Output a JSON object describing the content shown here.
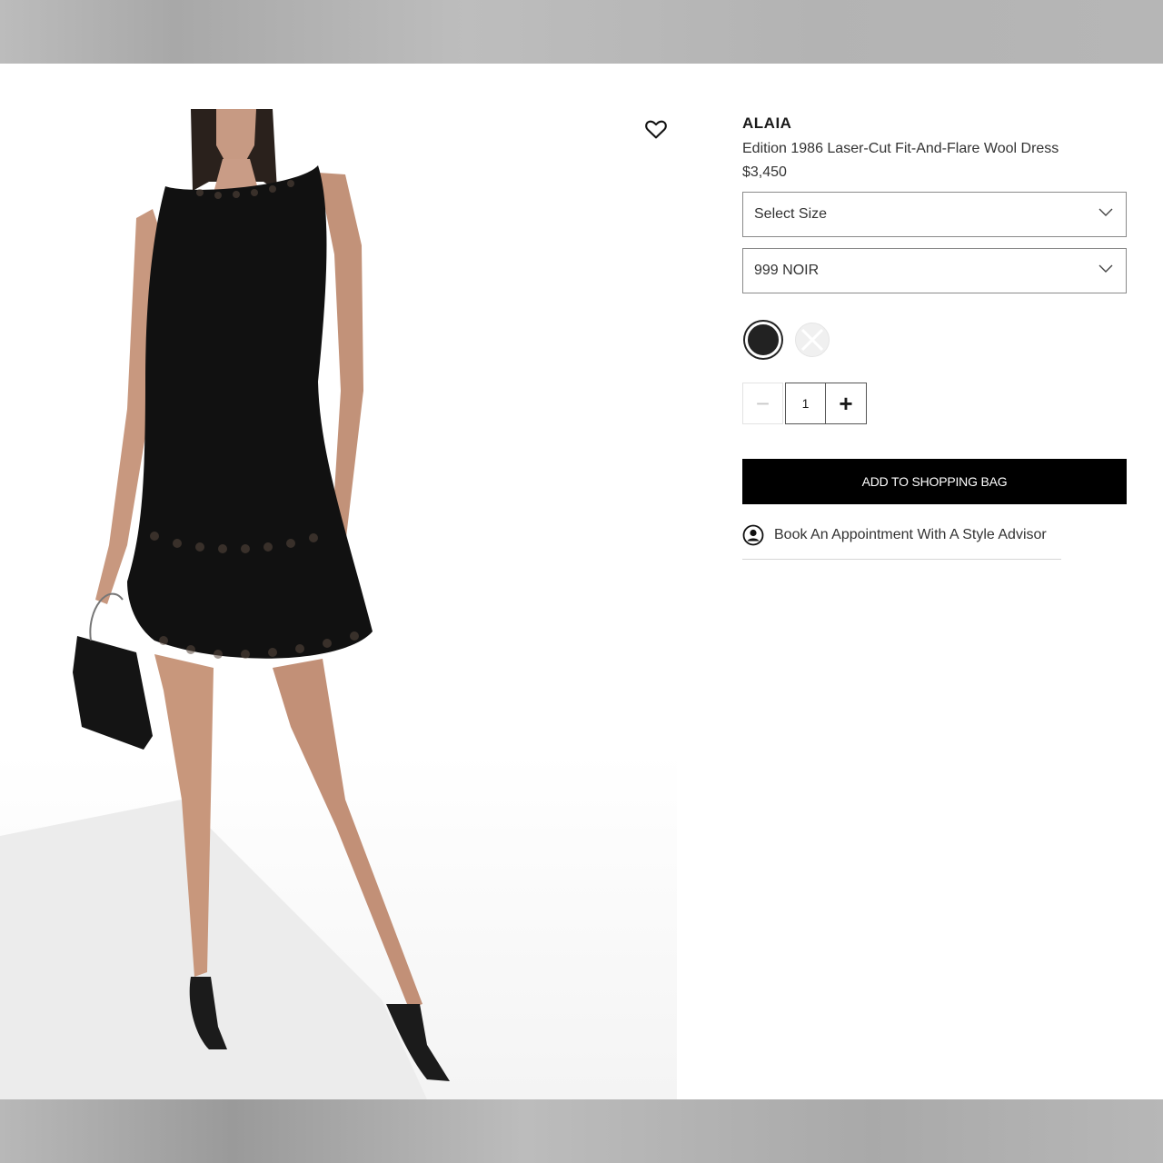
{
  "product": {
    "brand": "ALAIA",
    "name": "Edition 1986 Laser-Cut Fit-And-Flare Wool Dress",
    "price": "$3,450"
  },
  "options": {
    "size_select": "Select Size",
    "color_select": "999 NOIR"
  },
  "swatches": [
    {
      "color": "#222222",
      "selected": true
    },
    {
      "color": "#f0f0f0",
      "selected": false,
      "unavailable": true
    }
  ],
  "quantity": {
    "value": "1",
    "minus_label": "−",
    "plus_label": "+"
  },
  "actions": {
    "add_to_bag": "ADD TO SHOPPING BAG",
    "appointment": "Book An Appointment With A Style Advisor"
  },
  "icons": [
    "heart-icon",
    "chevron-down-icon",
    "user-circle-icon"
  ]
}
